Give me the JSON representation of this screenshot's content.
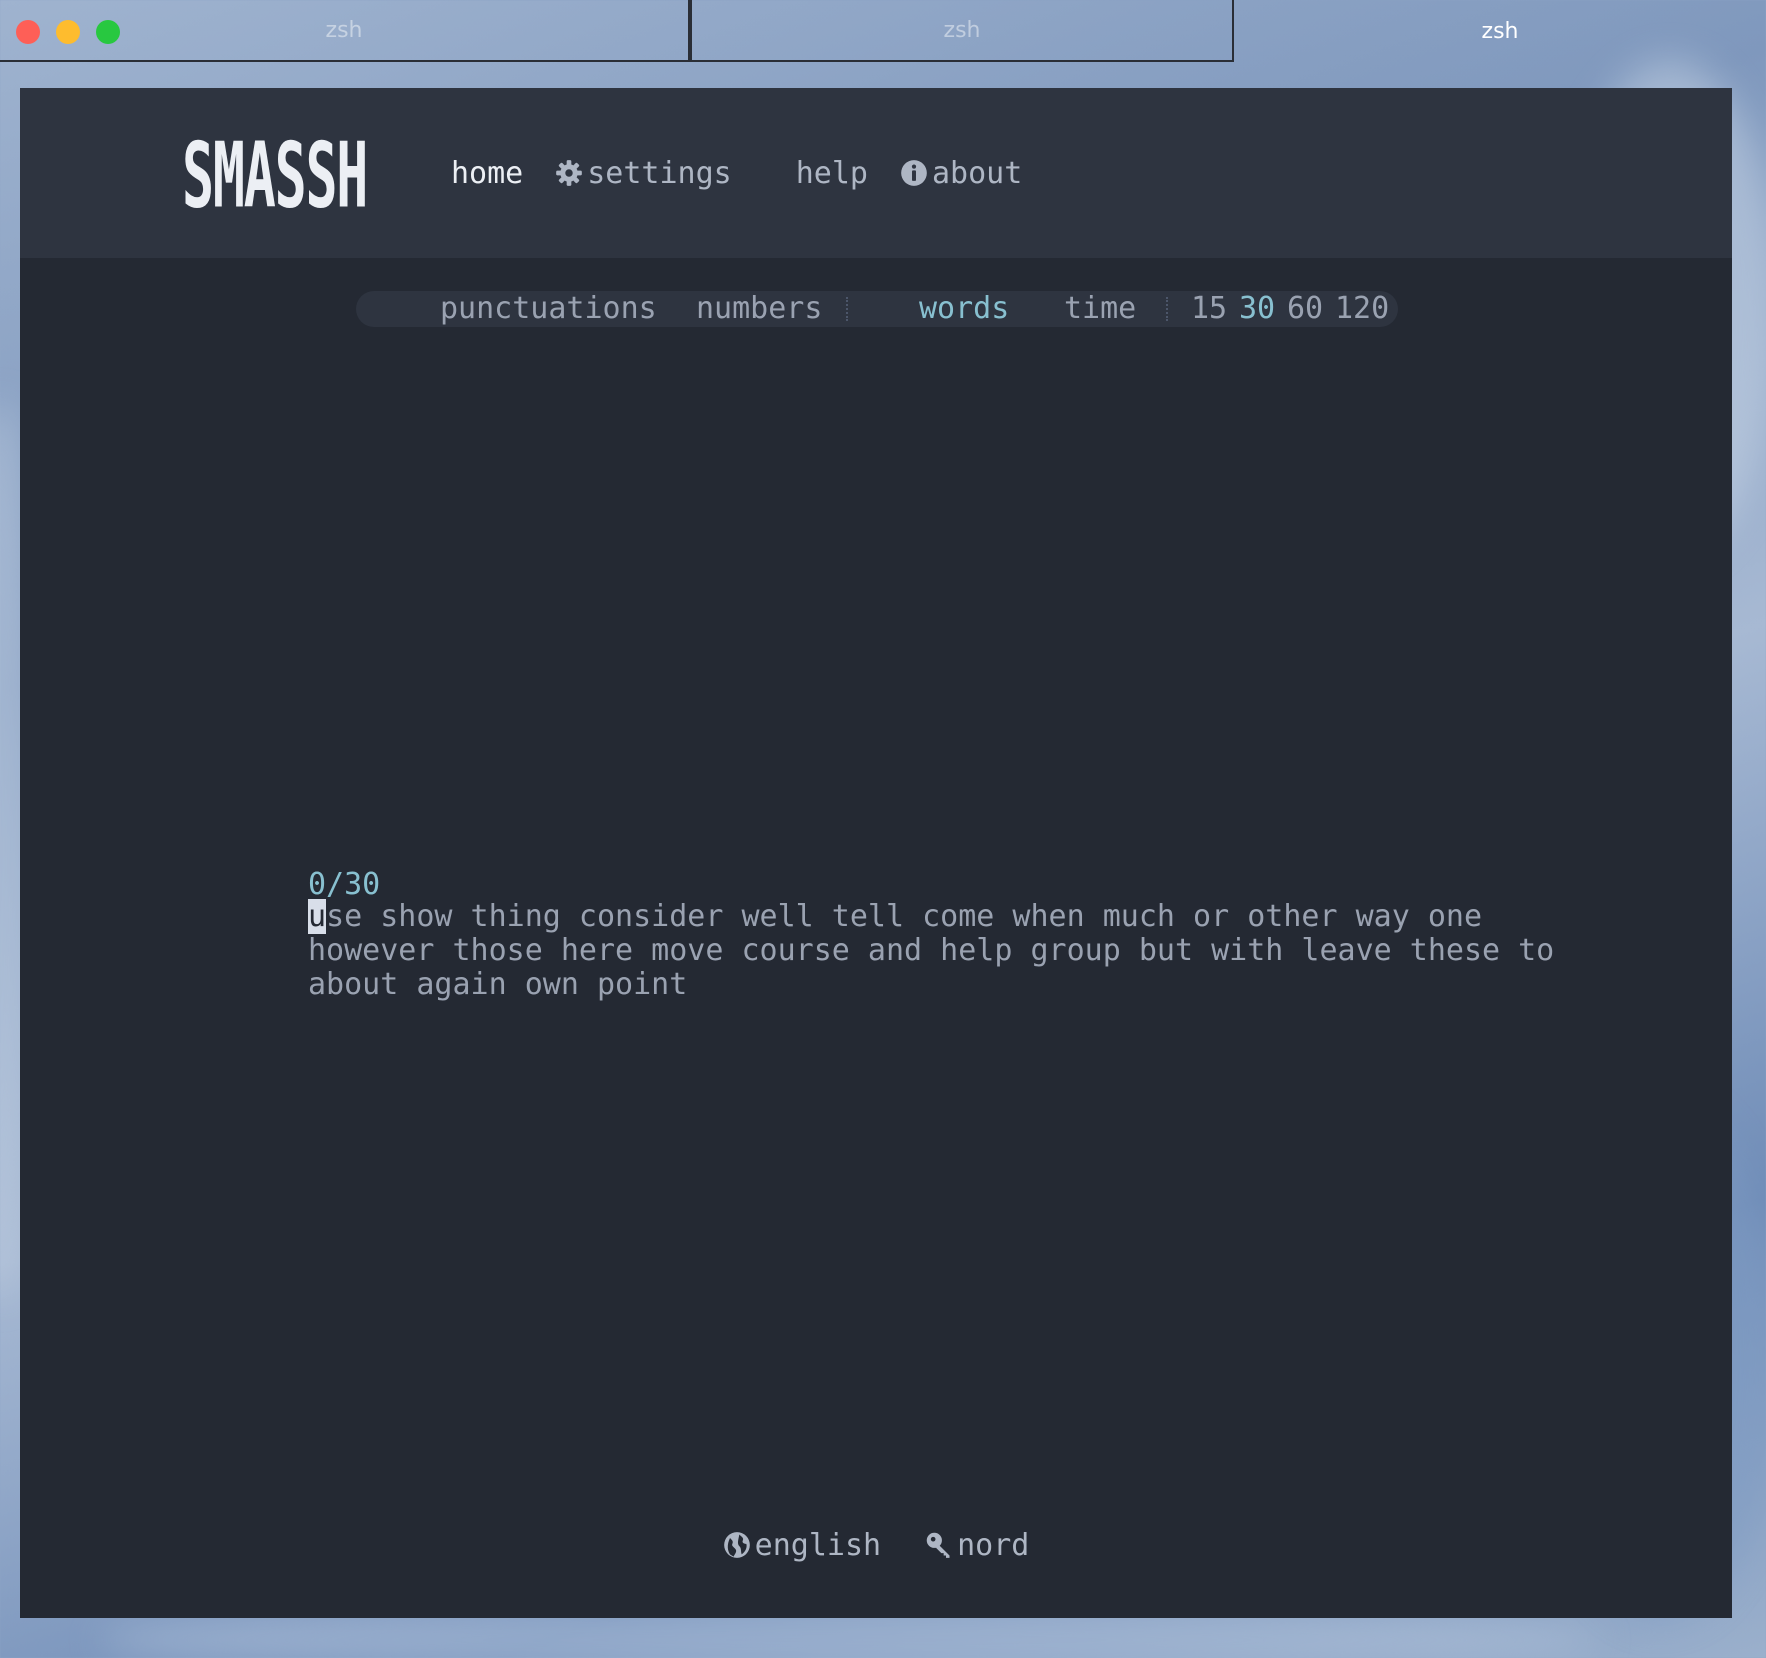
{
  "window": {
    "tabs": [
      {
        "label": "zsh",
        "active": false
      },
      {
        "label": "zsh",
        "active": false
      },
      {
        "label": "zsh",
        "active": true
      }
    ]
  },
  "app": {
    "logo_text": "SMASSH"
  },
  "nav": {
    "home": "home",
    "settings": "settings",
    "help": "help",
    "about": "about"
  },
  "modebar": {
    "punctuations": "punctuations",
    "numbers": "numbers",
    "words": "words",
    "time": "time",
    "counts": [
      "15",
      "30",
      "60",
      "120"
    ],
    "selected_mode": "words",
    "selected_count": "30"
  },
  "test": {
    "progress": "0/30",
    "cursor_char": "u",
    "lines": [
      "se show thing consider well tell come when much or other way one",
      "however those here move course and help group but with leave these to",
      "about again own point"
    ]
  },
  "footer": {
    "language": "english",
    "theme": "nord"
  },
  "colors": {
    "accent": "#88c0d0",
    "background": "#242933",
    "header": "#2e3440",
    "text": "#9aa2b1",
    "text_bright": "#eceff4"
  },
  "icons": {
    "settings": "gear-icon",
    "about": "info-icon",
    "language": "globe-icon",
    "theme": "key-icon"
  }
}
